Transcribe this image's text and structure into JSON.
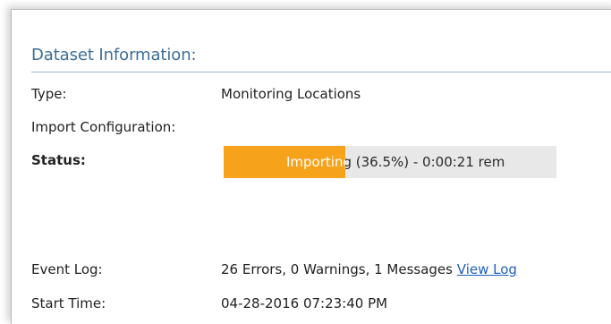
{
  "dataset": {
    "section_title": "Dataset Information:",
    "fields": {
      "type_label": "Type:",
      "type_value": "Monitoring Locations",
      "import_config_label": "Import Configuration:",
      "import_config_value": "",
      "status_label": "Status:",
      "event_log_label": "Event Log:",
      "event_log_summary": "26 Errors, 0 Warnings, 1 Messages",
      "view_log_link": "View Log",
      "start_time_label": "Start Time:",
      "start_time_value": "04-28-2016 07:23:40 PM"
    },
    "progress": {
      "text": "Importing (36.5%) - 0:00:21 rem",
      "percent": 36.5,
      "fill_color": "#f7a21b",
      "track_color": "#e8e8e8"
    },
    "colors": {
      "title": "#3c6e99",
      "link": "#1f5fbf"
    }
  }
}
